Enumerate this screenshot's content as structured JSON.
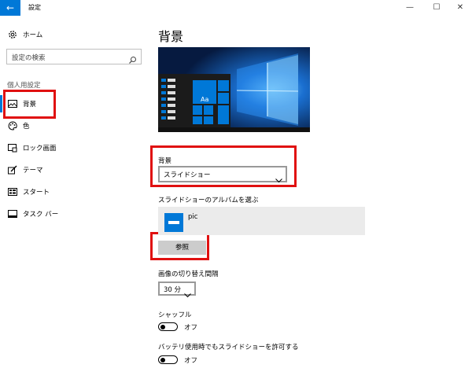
{
  "window": {
    "title": "設定",
    "back_glyph": "←",
    "minimize_glyph": "—",
    "maximize_glyph": "☐",
    "close_glyph": "✕"
  },
  "sidebar": {
    "home_label": "ホーム",
    "search_placeholder": "設定の検索",
    "section_title": "個人用設定",
    "items": [
      {
        "label": "背景",
        "icon": "image-icon",
        "active": true
      },
      {
        "label": "色",
        "icon": "palette-icon"
      },
      {
        "label": "ロック画面",
        "icon": "lock-screen-icon"
      },
      {
        "label": "テーマ",
        "icon": "theme-brush-icon"
      },
      {
        "label": "スタート",
        "icon": "start-grid-icon"
      },
      {
        "label": "タスク バー",
        "icon": "taskbar-icon"
      }
    ]
  },
  "main": {
    "page_title": "背景",
    "preview": {
      "tile_text": "Aa"
    },
    "background_label": "背景",
    "background_value": "スライドショー",
    "album_label": "スライドショーのアルバムを選ぶ",
    "album_name": "pic",
    "browse_label": "参照",
    "interval_label": "画像の切り替え間隔",
    "interval_value": "30 分",
    "shuffle_label": "シャッフル",
    "shuffle_state": "オフ",
    "battery_label": "バッテリ使用時でもスライドショーを許可する",
    "battery_state": "オフ"
  },
  "colors": {
    "accent": "#0078d7",
    "highlight_box": "#e01010"
  }
}
